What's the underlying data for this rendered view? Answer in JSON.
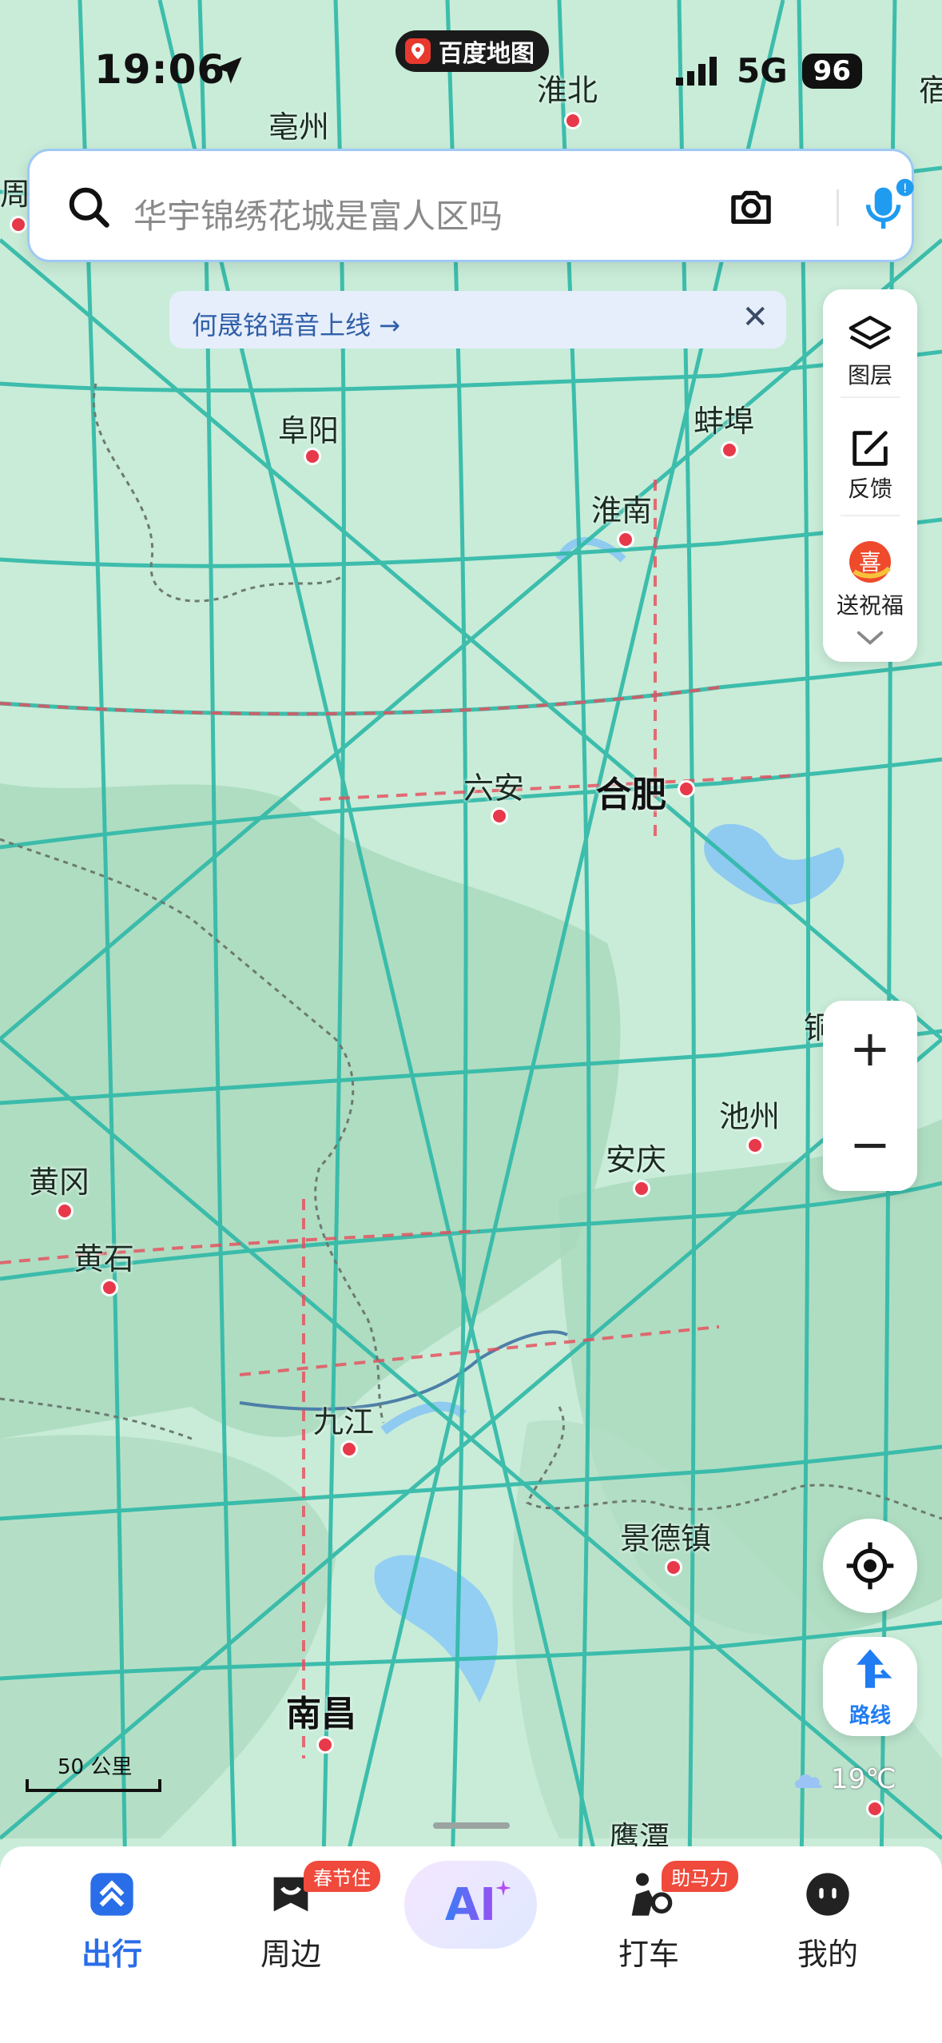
{
  "status_bar": {
    "time": "19:06",
    "network": "5G",
    "battery": "96"
  },
  "app_pill": {
    "label": "百度地图"
  },
  "search": {
    "placeholder": "华宇锦绣花城是富人区吗"
  },
  "notice": {
    "text": "何晟铭语音上线 →",
    "close": "✕"
  },
  "side_toolbar": {
    "layers_label": "图层",
    "feedback_label": "反馈",
    "promo_label": "送祝福"
  },
  "zoom": {
    "in": "+",
    "out": "−"
  },
  "route_button": {
    "label": "路线"
  },
  "scale": {
    "label": "50 公里"
  },
  "weather": {
    "temp": "19℃"
  },
  "map_labels": [
    {
      "name": "亳州"
    },
    {
      "name": "淮北"
    },
    {
      "name": "阜阳"
    },
    {
      "name": "蚌埠"
    },
    {
      "name": "淮南"
    },
    {
      "name": "六安"
    },
    {
      "name": "合肥"
    },
    {
      "name": "池州"
    },
    {
      "name": "安庆"
    },
    {
      "name": "黄冈"
    },
    {
      "name": "黄石"
    },
    {
      "name": "九江"
    },
    {
      "name": "景德镇"
    },
    {
      "name": "南昌"
    },
    {
      "name": "鹰潭"
    },
    {
      "name": "铜"
    },
    {
      "name": "宿"
    },
    {
      "name": "周"
    }
  ],
  "bottom_nav": {
    "items": [
      {
        "label": "出行",
        "badge": ""
      },
      {
        "label": "周边",
        "badge": "春节住"
      },
      {
        "label": "AI"
      },
      {
        "label": "打车",
        "badge": "助马力"
      },
      {
        "label": "我的",
        "badge": ""
      }
    ]
  },
  "colors": {
    "map_bg": "#c8ecd8",
    "road": "#2fb9a8",
    "accent": "#2a6de8",
    "badge": "#ef4a3c"
  }
}
